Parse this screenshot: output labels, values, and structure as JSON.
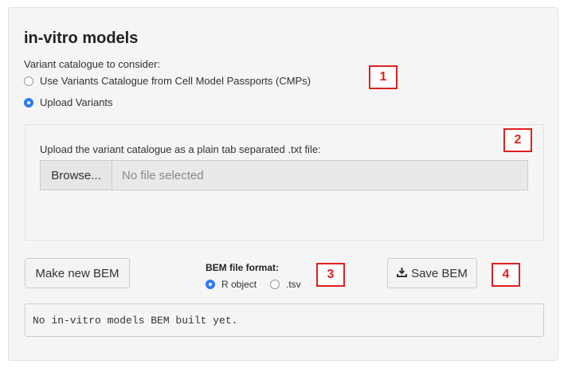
{
  "panel": {
    "title": "in-vitro models"
  },
  "variant_catalogue": {
    "label": "Variant catalogue to consider:",
    "options": [
      {
        "label": "Use Variants Catalogue from Cell Model Passports (CMPs)",
        "selected": false
      },
      {
        "label": "Upload Variants",
        "selected": true
      }
    ]
  },
  "upload": {
    "label": "Upload the variant catalogue as a plain tab separated .txt file:",
    "browse_label": "Browse...",
    "placeholder": "No file selected"
  },
  "actions": {
    "make_bem_label": "Make new BEM",
    "format_title": "BEM file format:",
    "format_options": [
      {
        "label": "R object",
        "selected": true
      },
      {
        "label": ".tsv",
        "selected": false
      }
    ],
    "save_label": "Save BEM",
    "save_icon": "download-icon"
  },
  "output": {
    "text": "No in-vitro models BEM built yet."
  },
  "callouts": [
    "1",
    "2",
    "3",
    "4"
  ],
  "colors": {
    "accent": "#2f7bf5",
    "callout": "#e02020",
    "panel_bg": "#f5f5f5"
  }
}
